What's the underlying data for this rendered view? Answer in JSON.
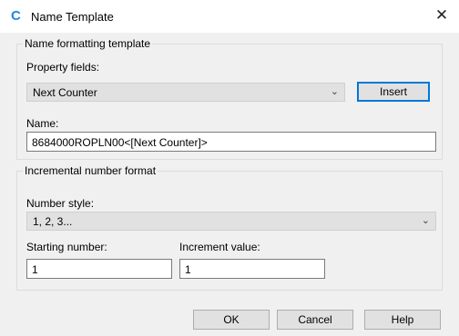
{
  "window": {
    "title": "Name Template",
    "app_icon_glyph": "C",
    "close_glyph": "✕"
  },
  "name_group": {
    "title": "Name formatting template",
    "property_fields_label": "Property fields:",
    "property_fields_value": "Next Counter",
    "insert_label": "Insert",
    "name_label": "Name:",
    "name_value": "8684000ROPLN00<[Next Counter]>"
  },
  "number_group": {
    "title": "Incremental number format",
    "number_style_label": "Number style:",
    "number_style_value": "1, 2, 3...",
    "starting_number_label": "Starting number:",
    "starting_number_value": "1",
    "increment_value_label": "Increment value:",
    "increment_value_value": "1"
  },
  "buttons": {
    "ok_label": "OK",
    "cancel_label": "Cancel",
    "help_label": "Help"
  },
  "colors": {
    "accent": "#1e88e5",
    "default_button_border": "#0078d7",
    "dialog_background": "#f0f0f0"
  }
}
